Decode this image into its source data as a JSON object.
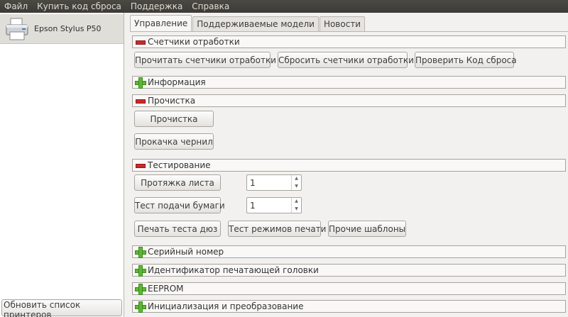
{
  "menubar": {
    "items": [
      "Файл",
      "Купить код сброса",
      "Поддержка",
      "Справка"
    ]
  },
  "sidebar": {
    "printer_name": "Epson Stylus P50",
    "refresh_label": "Обновить список принтеров"
  },
  "tabs": [
    {
      "label": "Управление",
      "active": true
    },
    {
      "label": "Поддерживаемые модели",
      "active": false
    },
    {
      "label": "Новости",
      "active": false
    }
  ],
  "sections": {
    "counters": {
      "title": "Счетчики отработки",
      "read_label": "Прочитать счетчики отработки",
      "reset_label": "Сбросить счетчики отработки",
      "check_label": "Проверить Код сброса"
    },
    "info": {
      "title": "Информация"
    },
    "cleaning": {
      "title": "Прочистка",
      "clean_label": "Прочистка",
      "ink_label": "Прокачка чернил"
    },
    "testing": {
      "title": "Тестирование",
      "sheet_feed_label": "Протяжка листа",
      "sheet_feed_value": "1",
      "paper_feed_label": "Тест подачи бумаги",
      "paper_feed_value": "1",
      "nozzle_label": "Печать теста дюз",
      "modes_label": "Тест режимов печати",
      "other_label": "Прочие шаблоны"
    },
    "serial": {
      "title": "Серийный номер"
    },
    "head_id": {
      "title": "Идентификатор печатающей головки"
    },
    "eeprom": {
      "title": "EEPROM"
    },
    "init": {
      "title": "Инициализация и преобразование"
    }
  },
  "colors": {
    "menubar_bg": "#3c3b37",
    "minus_icon": "#cc2a2a",
    "plus_icon": "#5fb832"
  }
}
